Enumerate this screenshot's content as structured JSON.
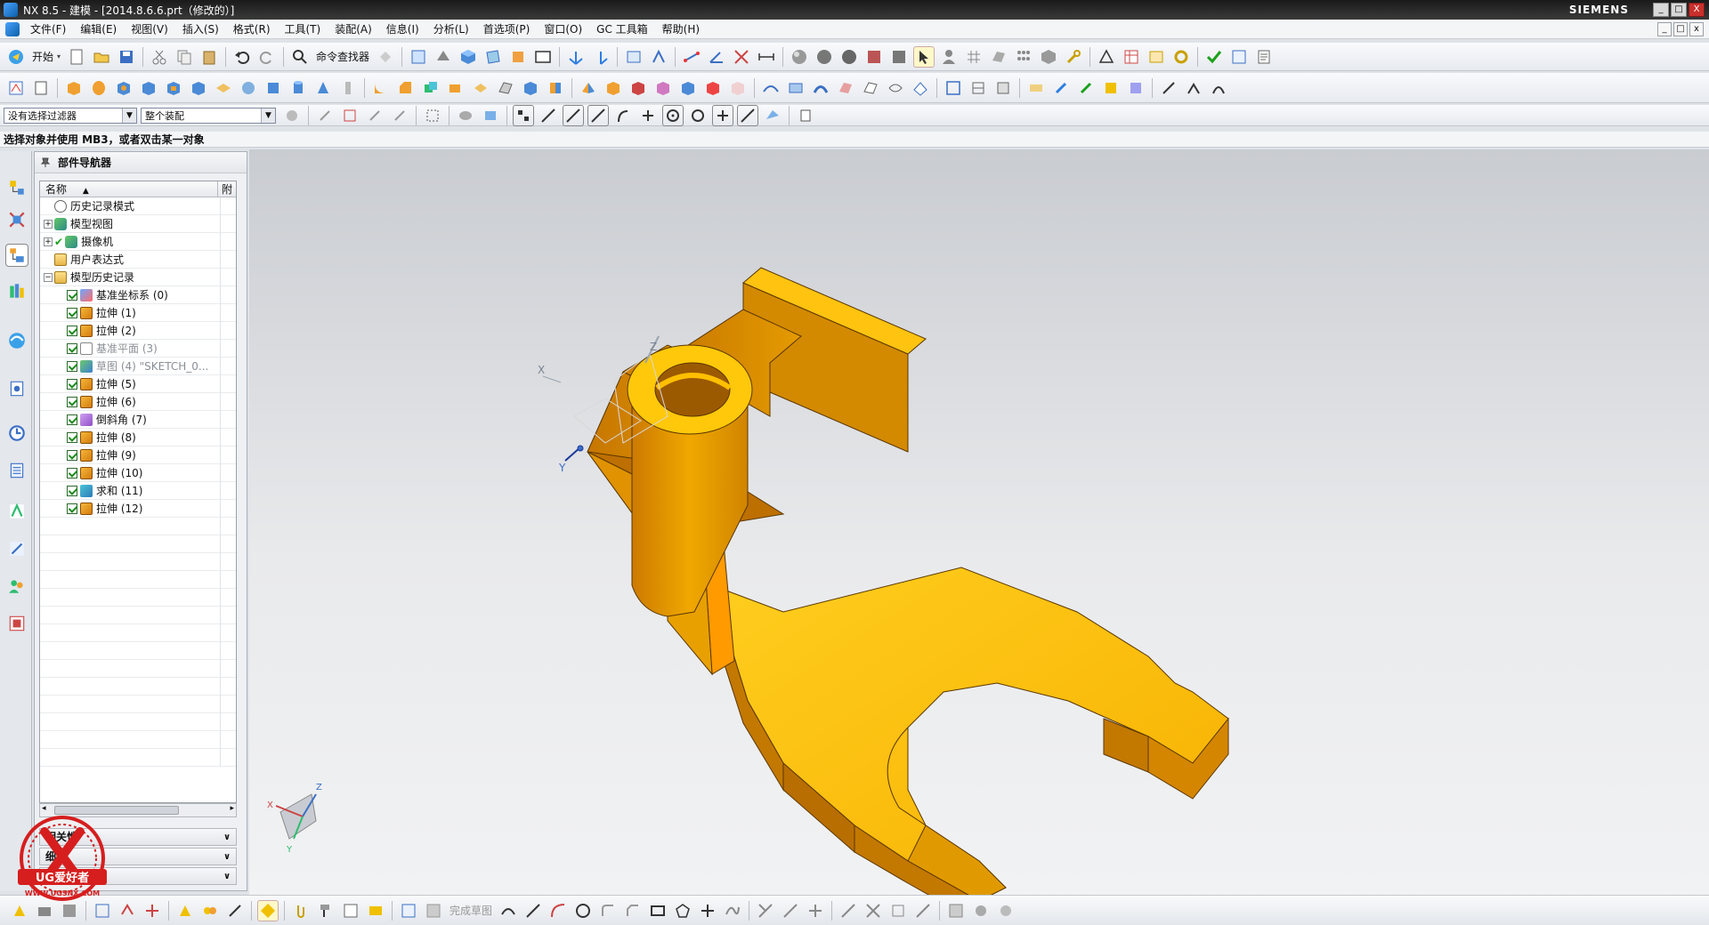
{
  "window": {
    "title": "NX 8.5 - 建模 - [2014.8.6.6.prt（修改的）]",
    "brand": "SIEMENS",
    "controls": [
      "_",
      "□",
      "X"
    ]
  },
  "menu": {
    "items": [
      "文件(F)",
      "编辑(E)",
      "视图(V)",
      "插入(S)",
      "格式(R)",
      "工具(T)",
      "装配(A)",
      "信息(I)",
      "分析(L)",
      "首选项(P)",
      "窗口(O)",
      "GC 工具箱",
      "帮助(H)"
    ]
  },
  "toolbar1": {
    "start_label": "开始",
    "command_finder_label": "命令查找器"
  },
  "selection_bar": {
    "filter_value": "没有选择过滤器",
    "scope_value": "整个装配"
  },
  "status": {
    "prompt": "选择对象并使用 MB3，或者双击某一对象"
  },
  "navigator": {
    "title": "部件导航器",
    "col_name": "名称",
    "col_attach": "附",
    "nodes": [
      {
        "label": "历史记录模式",
        "icon": "history-icon",
        "indent": 1
      },
      {
        "label": "模型视图",
        "icon": "views-icon",
        "indent": 1,
        "expand": "+"
      },
      {
        "label": "摄像机",
        "icon": "camera-icon",
        "indent": 1,
        "expand": "+"
      },
      {
        "label": "用户表达式",
        "icon": "folder-icon",
        "indent": 1
      },
      {
        "label": "模型历史记录",
        "icon": "folder-icon",
        "indent": 1,
        "expand": "−"
      },
      {
        "label": "基准坐标系 (0)",
        "icon": "datum-csys-icon",
        "check": true,
        "indent": 2
      },
      {
        "label": "拉伸 (1)",
        "icon": "extrude-icon",
        "check": true,
        "indent": 2
      },
      {
        "label": "拉伸 (2)",
        "icon": "extrude-icon",
        "check": true,
        "indent": 2
      },
      {
        "label": "基准平面 (3)",
        "icon": "datum-plane-icon",
        "check": true,
        "indent": 2,
        "dim": true
      },
      {
        "label": "草图 (4) \"SKETCH_0...",
        "icon": "sketch-icon",
        "check": true,
        "indent": 2,
        "dim": true
      },
      {
        "label": "拉伸 (5)",
        "icon": "extrude-icon",
        "check": true,
        "indent": 2
      },
      {
        "label": "拉伸 (6)",
        "icon": "extrude-icon",
        "check": true,
        "indent": 2
      },
      {
        "label": "倒斜角 (7)",
        "icon": "chamfer-icon",
        "check": true,
        "indent": 2
      },
      {
        "label": "拉伸 (8)",
        "icon": "extrude-icon",
        "check": true,
        "indent": 2
      },
      {
        "label": "拉伸 (9)",
        "icon": "extrude-icon",
        "check": true,
        "indent": 2
      },
      {
        "label": "拉伸 (10)",
        "icon": "extrude-icon",
        "check": true,
        "indent": 2
      },
      {
        "label": "求和 (11)",
        "icon": "unite-icon",
        "check": true,
        "indent": 2
      },
      {
        "label": "拉伸 (12)",
        "icon": "extrude-icon",
        "check": true,
        "indent": 2
      }
    ],
    "panels": [
      "相关性",
      "细节",
      "预览"
    ]
  },
  "viewport": {
    "axis_labels": {
      "x": "X",
      "y": "Y",
      "z": "Z"
    },
    "model_color": "#f5b400"
  },
  "bottom_toolbar": {
    "finish_sketch_label": "完成草图"
  },
  "watermark": {
    "text": "UG爱好者",
    "url": "WWW.UGSNX.COM"
  }
}
